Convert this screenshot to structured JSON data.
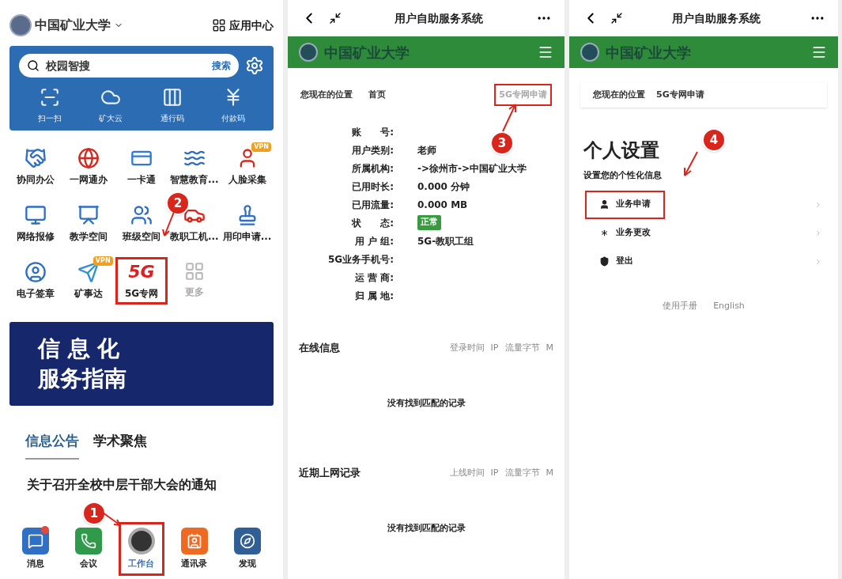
{
  "home": {
    "logo_text": "中国矿业大学",
    "app_center": "应用中心",
    "search": {
      "placeholder": "校园智搜",
      "button": "搜索"
    },
    "quick_actions": [
      {
        "label": "扫一扫"
      },
      {
        "label": "矿大云"
      },
      {
        "label": "通行码"
      },
      {
        "label": "付款码"
      }
    ],
    "apps": [
      {
        "label": "协同办公",
        "kind": "icon",
        "highlighted": false
      },
      {
        "label": "一网通办",
        "kind": "icon",
        "highlighted": false
      },
      {
        "label": "一卡通",
        "kind": "icon",
        "highlighted": false
      },
      {
        "label": "智慧教育...",
        "kind": "icon",
        "highlighted": false
      },
      {
        "label": "人脸采集",
        "kind": "icon",
        "badge": "VPN",
        "highlighted": false
      },
      {
        "label": "网络报修",
        "kind": "icon",
        "highlighted": false
      },
      {
        "label": "教学空间",
        "kind": "icon",
        "highlighted": false
      },
      {
        "label": "班级空间",
        "kind": "icon",
        "highlighted": false
      },
      {
        "label": "教职工机...",
        "kind": "icon",
        "highlighted": false
      },
      {
        "label": "用印申请...",
        "kind": "icon",
        "highlighted": false
      },
      {
        "label": "电子签章",
        "kind": "icon",
        "highlighted": false
      },
      {
        "label": "矿事达",
        "kind": "icon",
        "badge": "VPN",
        "highlighted": false
      },
      {
        "label": "5G专网",
        "kind": "logo",
        "logo": "5G",
        "highlighted": true
      },
      {
        "label": "更多",
        "kind": "more",
        "highlighted": false
      }
    ],
    "banner": {
      "line_1": "信 息 化",
      "line_2": "服务指南"
    },
    "tabs": [
      {
        "label": "信息公告",
        "selected": true
      },
      {
        "label": "学术聚焦",
        "selected": false
      }
    ],
    "news_title": "关于召开全校中层干部大会的通知",
    "bottom_nav": [
      {
        "label": "消息",
        "selected": false,
        "highlighted": false,
        "unread": true
      },
      {
        "label": "会议",
        "selected": false,
        "highlighted": false,
        "unread": false
      },
      {
        "label": "工作台",
        "selected": true,
        "highlighted": true,
        "unread": false
      },
      {
        "label": "通讯录",
        "selected": false,
        "highlighted": false,
        "unread": false
      },
      {
        "label": "发现",
        "selected": false,
        "highlighted": false,
        "unread": false
      }
    ],
    "markers": [
      {
        "number": "1"
      },
      {
        "number": "2"
      }
    ]
  },
  "portal": {
    "title": "用户自助服务系统",
    "logo_text": "中国矿业大学",
    "breadcrumb": {
      "label": "您现在的位置",
      "current": "首页"
    },
    "apply_link": {
      "label": "5G专网申请",
      "highlighted": true
    },
    "fields": [
      {
        "label": "账　　号:",
        "kind": "text"
      },
      {
        "label": "用户类别:",
        "kind": "text",
        "value": "老师"
      },
      {
        "label": "所属机构:",
        "kind": "text",
        "value": "->徐州市->中国矿业大学"
      },
      {
        "label": "已用时长:",
        "kind": "text",
        "value": "0.000 分钟"
      },
      {
        "label": "已用流量:",
        "kind": "text",
        "value": "0.000 MB"
      },
      {
        "label": "状　　态:",
        "kind": "status",
        "value": "正常"
      },
      {
        "label": "用 户 组:",
        "kind": "text",
        "value": "5G-教职工组"
      },
      {
        "label": "5G业务手机号:",
        "kind": "text"
      },
      {
        "label": "运 营 商:",
        "kind": "text"
      },
      {
        "label": "归 属 地:",
        "kind": "text"
      }
    ],
    "sections": [
      {
        "title": "在线信息",
        "columns": [
          "登录时间",
          "IP",
          "流量字节",
          "M"
        ],
        "empty": "没有找到匹配的记录"
      },
      {
        "title": "近期上网记录",
        "columns": [
          "上线时间",
          "IP",
          "流量字节",
          "M"
        ],
        "empty": "没有找到匹配的记录"
      }
    ],
    "markers": [
      {
        "number": "3"
      }
    ]
  },
  "settings": {
    "title": "用户自助服务系统",
    "logo_text": "中国矿业大学",
    "breadcrumb": {
      "label": "您现在的位置",
      "current": "5G专网申请"
    },
    "heading": "个人设置",
    "subheading": "设置您的个性化信息",
    "menu": [
      {
        "label": "业务申请",
        "highlighted": true
      },
      {
        "label": "业务更改",
        "highlighted": false
      },
      {
        "label": "登出",
        "highlighted": false
      }
    ],
    "footer_links": [
      "使用手册",
      "English"
    ],
    "markers": [
      {
        "number": "4"
      }
    ]
  }
}
